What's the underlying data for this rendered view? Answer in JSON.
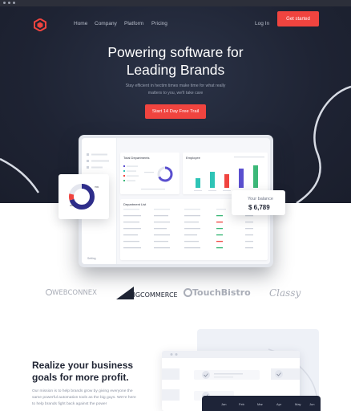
{
  "nav": {
    "items": [
      "Home",
      "Company",
      "Platform",
      "Pricing"
    ],
    "login": "Log In",
    "cta": "Get started"
  },
  "hero": {
    "title_line1": "Powering software for",
    "title_line2": "Leading Brands",
    "subtitle": "Stay efficient in hectim times make time for what really matters to you, we'll take care",
    "cta": "Start 14 Day Free Trail"
  },
  "dashboard": {
    "total_departments": "Total Departments",
    "employee": "Employee",
    "department_list": "Department List",
    "balance_label": "Your balance",
    "balance_value": "$ 6,789",
    "donut_values": [
      "70%",
      "30%"
    ],
    "sidebar_settings": "Setting"
  },
  "logos": [
    "WEBCONNEX",
    "BIGCOMMERCE",
    "TouchBistro",
    "Classy"
  ],
  "mission": {
    "title": "Realize your business goals for more profit.",
    "text": "Our mission is to help brands grow by giving everyone the same powerful automation tools as the big guys. We're here to help brands fight back against the power"
  },
  "months": [
    "Jan",
    "Feb",
    "Mar",
    "Apr",
    "May",
    "Jun"
  ],
  "colors": {
    "accent": "#f0443f",
    "hero_bg": "#1e2333",
    "purple": "#5a4fcf",
    "teal": "#2ec4b6",
    "green": "#3cb878"
  }
}
